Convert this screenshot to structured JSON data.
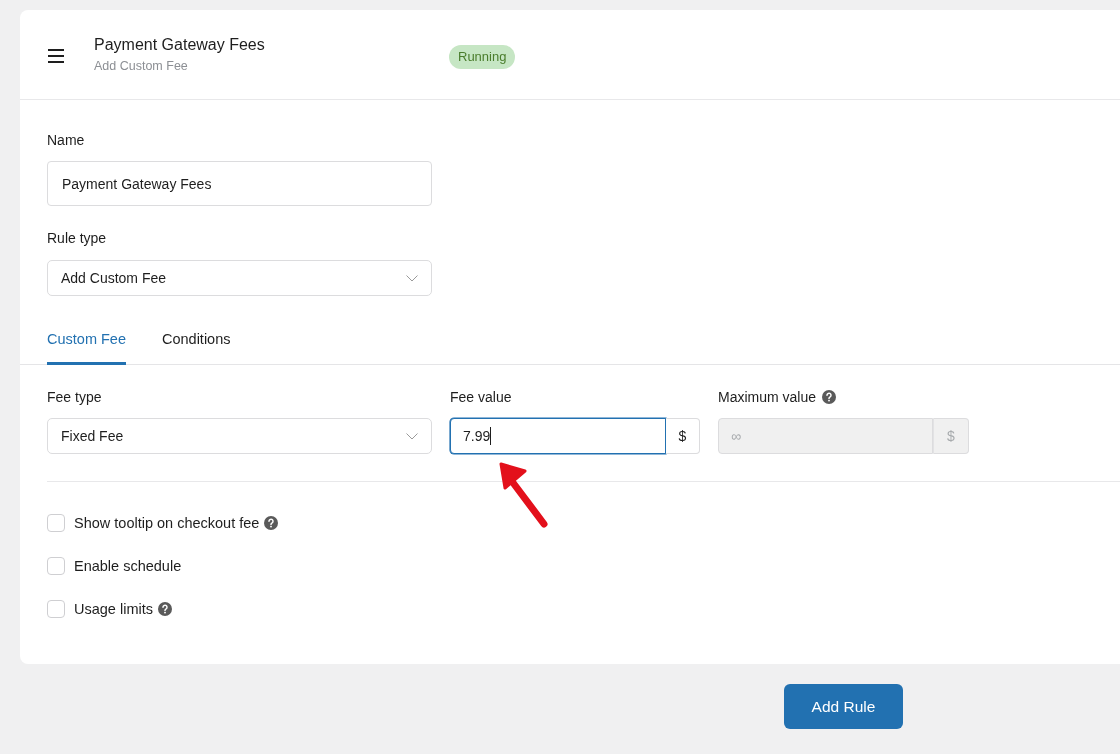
{
  "header": {
    "title": "Payment Gateway Fees",
    "subtitle": "Add Custom Fee",
    "status_badge": "Running"
  },
  "name_field": {
    "label": "Name",
    "value": "Payment Gateway Fees"
  },
  "rule_type": {
    "label": "Rule type",
    "value": "Add Custom Fee"
  },
  "tabs": [
    {
      "label": "Custom Fee",
      "selected": true
    },
    {
      "label": "Conditions",
      "selected": false
    }
  ],
  "fee_type": {
    "label": "Fee type",
    "value": "Fixed Fee"
  },
  "fee_value": {
    "label": "Fee value",
    "value": "7.99",
    "focused": true,
    "addon": "$"
  },
  "maximum_value": {
    "label": "Maximum value",
    "help": true,
    "placeholder": "∞",
    "disabled": true,
    "addon": "$"
  },
  "options": [
    {
      "label": "Show tooltip on checkout fee",
      "checked": false,
      "help": true
    },
    {
      "label": "Enable schedule",
      "checked": false,
      "help": false
    },
    {
      "label": "Usage limits",
      "checked": false,
      "help": true
    }
  ],
  "submit_button": "Add Rule"
}
